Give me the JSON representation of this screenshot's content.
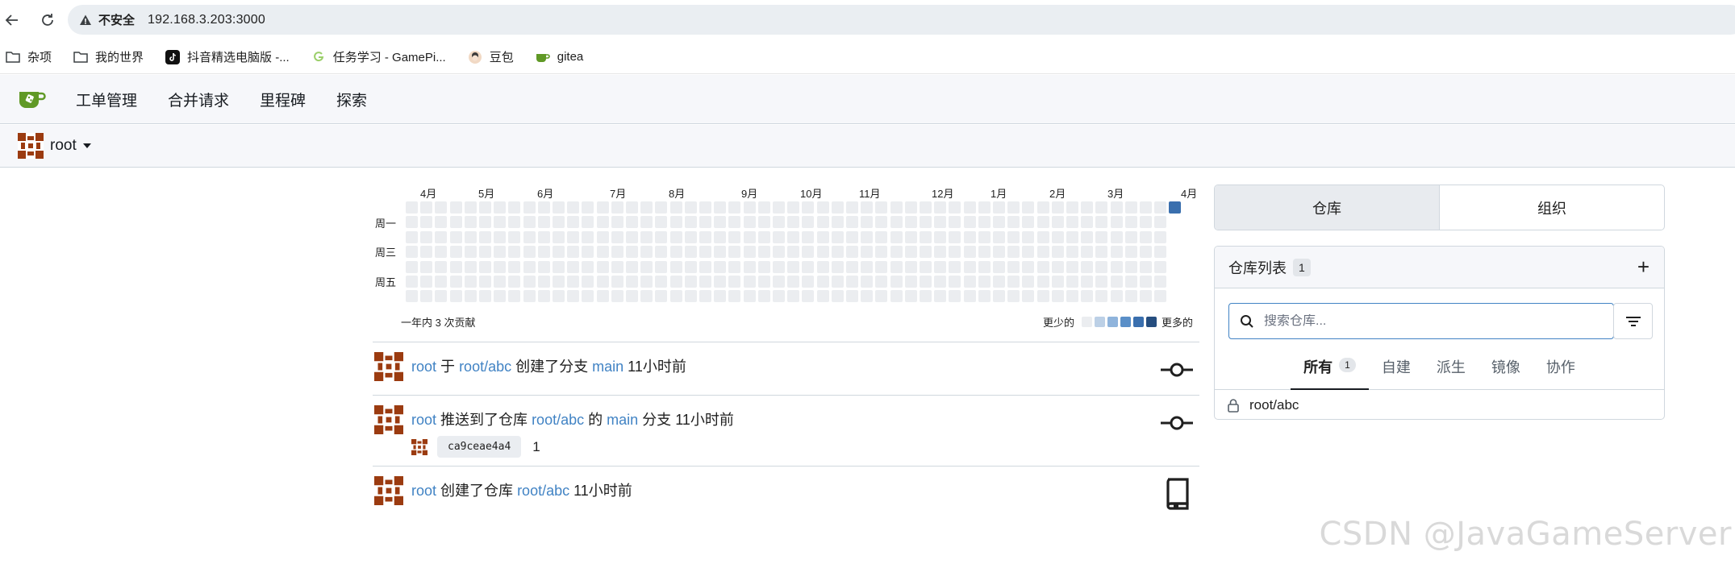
{
  "browser": {
    "security_label": "不安全",
    "url": "192.168.3.203:3000",
    "bookmarks": [
      {
        "label": "杂项",
        "icon": "folder-icon"
      },
      {
        "label": "我的世界",
        "icon": "folder-icon"
      },
      {
        "label": "抖音精选电脑版 -...",
        "icon": "tiktok-icon"
      },
      {
        "label": "任务学习 - GamePi...",
        "icon": "g-logo-icon"
      },
      {
        "label": "豆包",
        "icon": "doubao-icon"
      },
      {
        "label": "gitea",
        "icon": "gitea-icon"
      }
    ]
  },
  "navbar": {
    "links": [
      "工单管理",
      "合并请求",
      "里程碑",
      "探索"
    ]
  },
  "context": {
    "user": "root"
  },
  "heatmap": {
    "months": [
      "4月",
      "5月",
      "6月",
      "7月",
      "8月",
      "9月",
      "10月",
      "11月",
      "12月",
      "1月",
      "2月",
      "3月",
      "4月"
    ],
    "days": [
      "周一",
      "周三",
      "周五"
    ],
    "summary": "一年内 3 次贡献",
    "legend_less": "更少的",
    "legend_more": "更多的",
    "total_contributions": 3,
    "colors": {
      "empty": "#ebedf0",
      "level1": "#bcd0e6",
      "level2": "#8fb4dc",
      "level3": "#5a8fc8",
      "level4": "#3a6fae",
      "level5": "#264e7f"
    }
  },
  "feed": [
    {
      "user": "root",
      "t1": "于",
      "repo": "root/abc",
      "t2": "创建了分支",
      "branch": "main",
      "time": "11小时前",
      "icon": "git-commit-icon"
    },
    {
      "user": "root",
      "t1": "推送到了仓库",
      "repo": "root/abc",
      "t2": "的",
      "branch": "main",
      "t3": "分支",
      "time": "11小时前",
      "commit_sha": "ca9ceae4a4",
      "commit_msg": "1",
      "icon": "git-commit-icon"
    },
    {
      "user": "root",
      "t1": "创建了仓库",
      "repo": "root/abc",
      "time": "11小时前",
      "icon": "repo-icon"
    }
  ],
  "right_panel": {
    "tabs": [
      "仓库",
      "组织"
    ],
    "repo_list_title": "仓库列表",
    "repo_count": "1",
    "search_placeholder": "搜索仓库...",
    "subtabs": [
      {
        "label": "所有",
        "count": "1"
      },
      {
        "label": "自建"
      },
      {
        "label": "派生"
      },
      {
        "label": "镜像"
      },
      {
        "label": "协作"
      }
    ],
    "repos": [
      "root/abc"
    ]
  },
  "watermark": "CSDN @JavaGameServer"
}
